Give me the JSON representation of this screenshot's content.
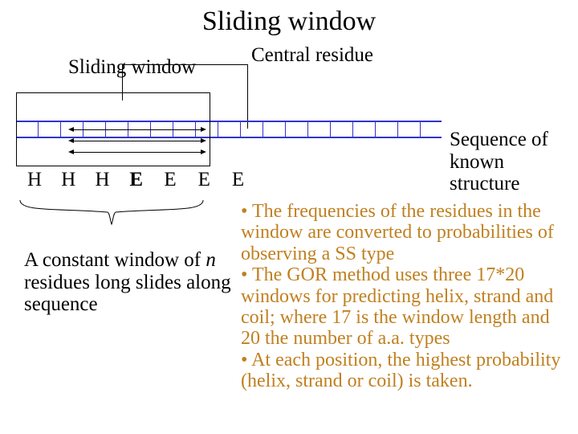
{
  "title": "Sliding window",
  "labels": {
    "sliding_window": "Sliding window",
    "central_residue": "Central residue",
    "sequence_known": "Sequence of\nknown structure",
    "constant_window_pre": "A constant window of ",
    "constant_window_n": "n",
    "constant_window_post": " residues long slides along sequence"
  },
  "sequence_letters": [
    "H",
    "H",
    "H",
    "E",
    "E",
    "E",
    "E"
  ],
  "sequence_bold_index": 3,
  "bullets": {
    "b1": "• The frequencies of the residues in the window are converted to probabilities of  observing a SS type",
    "b2": "• The GOR method uses three 17*20 windows for predicting helix, strand and coil; where 17 is the window length and 20 the number of a.a. types",
    "b3": "• At each position, the highest probability (helix, strand or coil) is taken."
  }
}
